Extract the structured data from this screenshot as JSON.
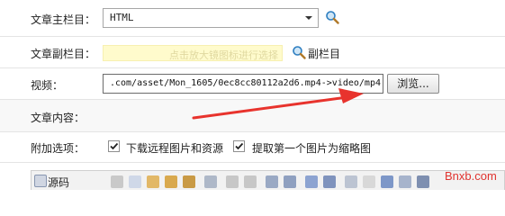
{
  "form": {
    "main_column_label": "文章主栏目：",
    "main_column_value": "HTML",
    "sub_column_label": "文章副栏目：",
    "sub_column_hint": "点击放大镜图标进行选择",
    "sub_column_link": "副栏目",
    "video_label": "视频：",
    "video_value": ".com/asset/Mon_1605/0ec8cc80112a2d6.mp4->video/mp4",
    "browse_button": "浏览...",
    "content_label": "文章内容：",
    "options_label": "附加选项：",
    "option_download_remote": "下载远程图片和资源",
    "option_download_remote_checked": true,
    "option_first_image_thumb": "提取第一个图片为缩略图",
    "option_first_image_thumb_checked": true
  },
  "editor": {
    "source_button": "源码"
  },
  "watermark": "Bnxb.com",
  "colors": {
    "arrow": "#e8332d",
    "options_bg": "#f8f8f8",
    "hint_bg": "#fffbcc"
  }
}
